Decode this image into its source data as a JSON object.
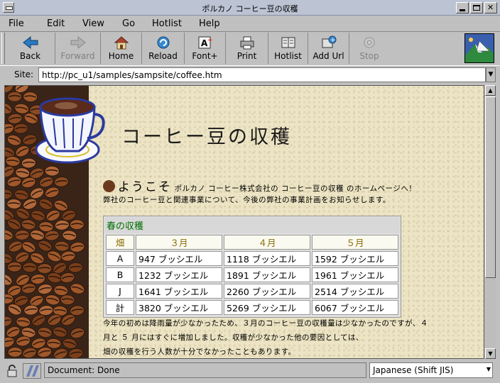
{
  "window": {
    "title": "ポルカノ コーヒー豆の収穫"
  },
  "menu": {
    "items": [
      "File",
      "Edit",
      "View",
      "Go",
      "Hotlist",
      "Help"
    ]
  },
  "toolbar": {
    "buttons": [
      {
        "label": "Back",
        "icon": "back-arrow-icon",
        "enabled": true
      },
      {
        "label": "Forward",
        "icon": "forward-arrow-icon",
        "enabled": false
      },
      {
        "label": "Home",
        "icon": "home-icon",
        "enabled": true
      },
      {
        "label": "Reload",
        "icon": "reload-icon",
        "enabled": true
      },
      {
        "label": "Font+",
        "icon": "font-plus-icon",
        "enabled": true
      },
      {
        "label": "Print",
        "icon": "print-icon",
        "enabled": true
      },
      {
        "label": "Hotlist",
        "icon": "hotlist-book-icon",
        "enabled": true
      },
      {
        "label": "Add Url",
        "icon": "add-url-icon",
        "enabled": true
      },
      {
        "label": "Stop",
        "icon": "stop-icon",
        "enabled": false
      }
    ]
  },
  "site": {
    "label": "Site:",
    "url": "http://pc_u1/samples/sampsite/coffee.htm"
  },
  "page": {
    "title": "コーヒー豆の収穫",
    "welcome_big": "ようこそ",
    "welcome_small": "ポルカノ コーヒー株式会社の コーヒー豆の収穫 のホームページへ！",
    "line2": "弊社のコーヒー豆と関連事業について、今後の弊社の事業計画をお知らせします。",
    "table": {
      "caption": "春の収穫",
      "header": [
        "畑",
        "３月",
        "４月",
        "５月"
      ],
      "rows": [
        [
          "A",
          "947 ブッシエル",
          "1118 ブッシエル",
          "1592 ブッシエル"
        ],
        [
          "B",
          "1232 ブッシエル",
          "1891 ブッシエル",
          "1961 ブッシエル"
        ],
        [
          "J",
          "1641 ブッシエル",
          "2260 ブッシエル",
          "2514 ブッシエル"
        ],
        [
          "計",
          "3820 ブッシエル",
          "5269 ブッシエル",
          "6067 ブッシエル"
        ]
      ]
    },
    "paragraph": [
      "今年の初めは降雨量が少なかったため、３月のコーヒー豆の収穫量は少なかったのですが、４",
      "月と ５ 月にはすぐに増加しました。収穫が少なかった他の要因としては、",
      "畑の収穫を行う人数が十分でなかったこともあります。"
    ]
  },
  "status": {
    "text": "Document: Done",
    "encoding": "Japanese (Shift JIS)"
  },
  "colors": {
    "table_caption": "#007000",
    "table_header": "#8a6a00",
    "page_bg": "#ece4c4"
  }
}
